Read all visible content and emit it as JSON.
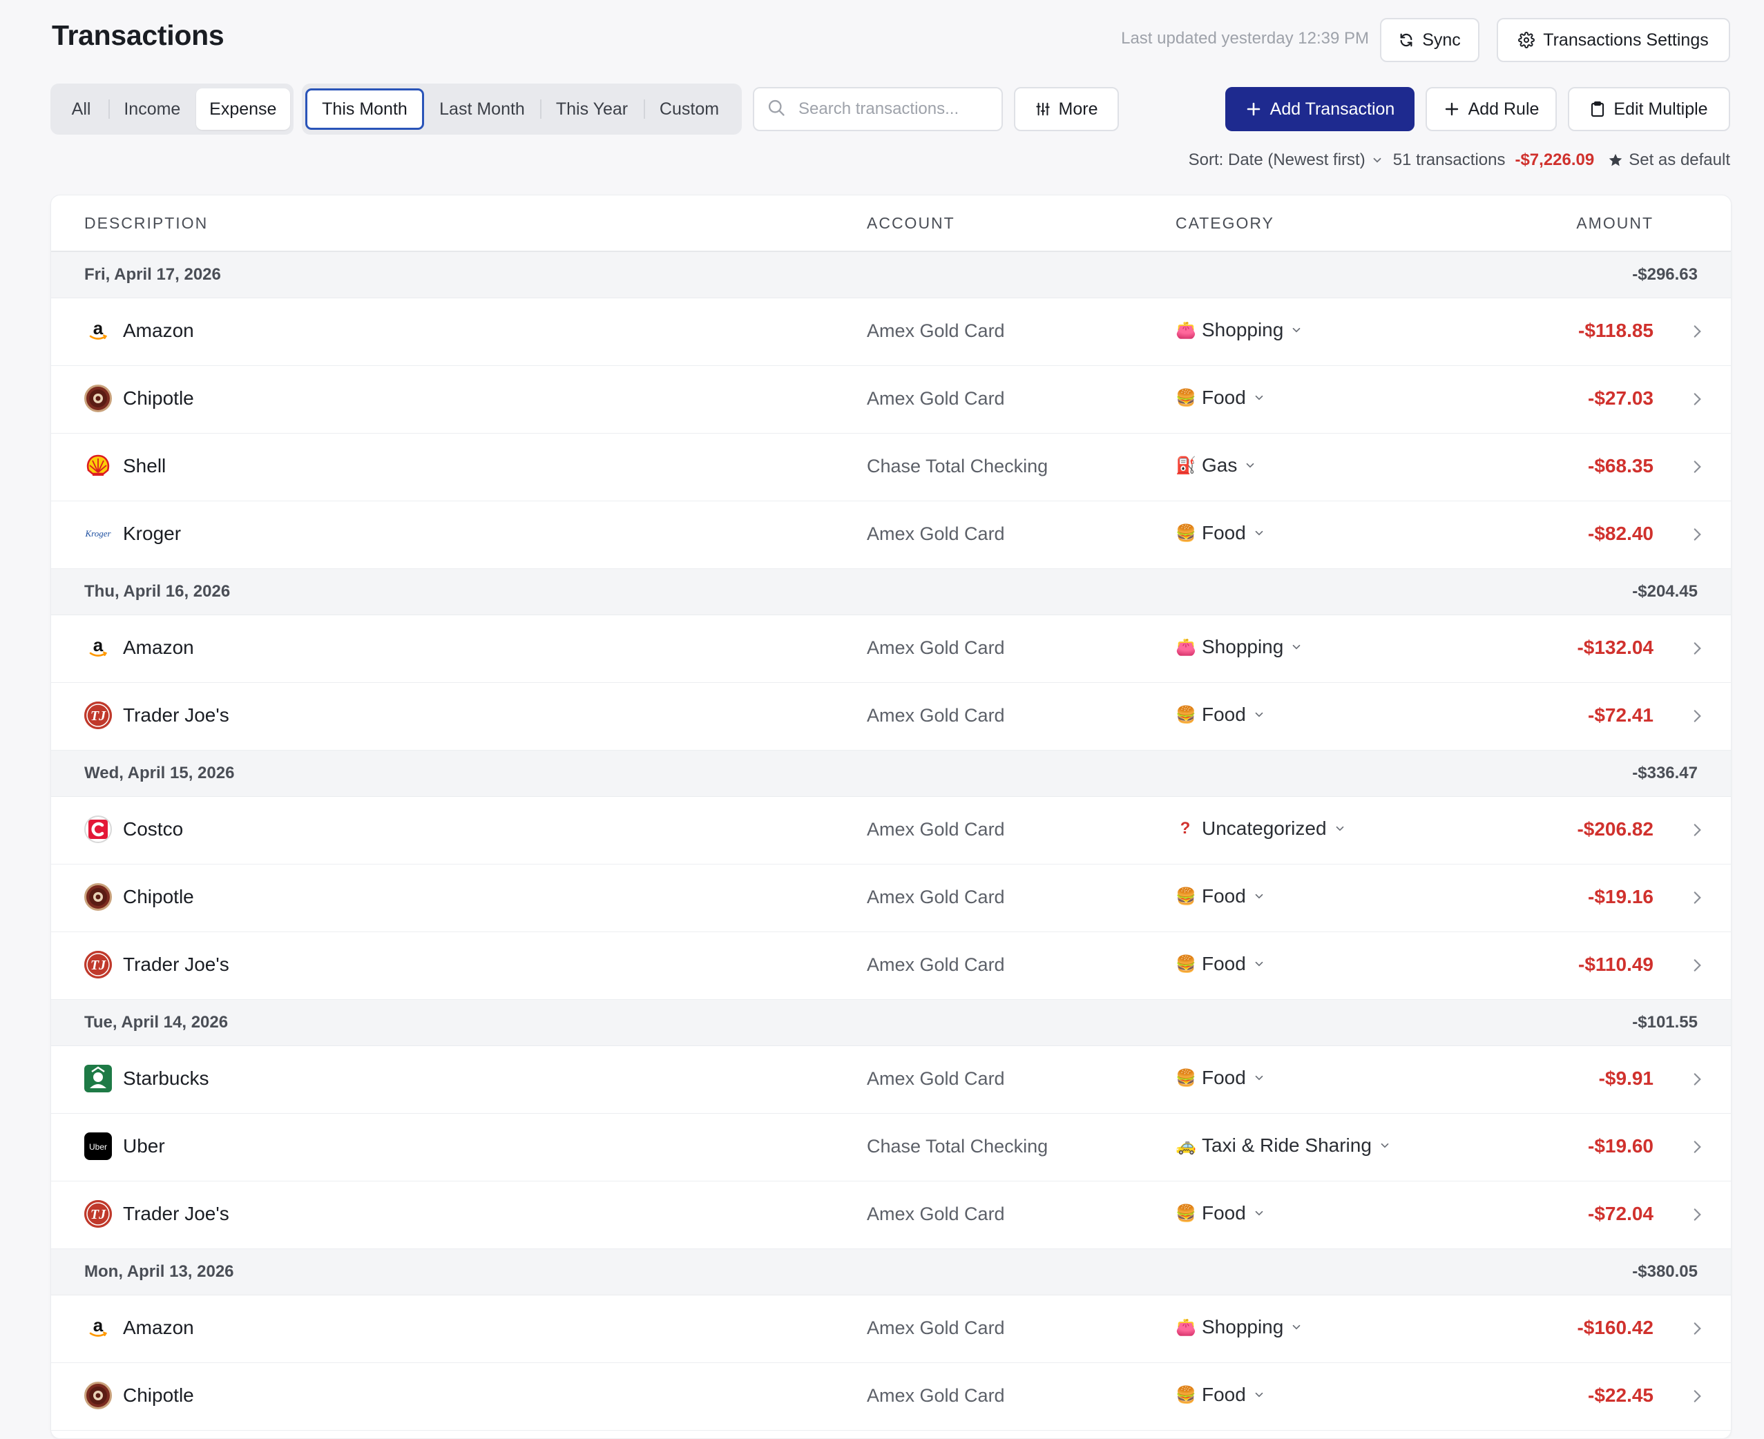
{
  "header": {
    "title": "Transactions",
    "last_updated": "Last updated yesterday 12:39 PM",
    "sync_label": "Sync",
    "settings_label": "Transactions Settings"
  },
  "filters": {
    "type_tabs": [
      {
        "label": "All",
        "active": false
      },
      {
        "label": "Income",
        "active": false
      },
      {
        "label": "Expense",
        "active": true
      }
    ],
    "period_tabs": [
      {
        "label": "This Month",
        "active": true
      },
      {
        "label": "Last Month",
        "active": false
      },
      {
        "label": "This Year",
        "active": false
      },
      {
        "label": "Custom",
        "active": false
      }
    ],
    "search_placeholder": "Search transactions...",
    "more_label": "More"
  },
  "actions": {
    "add_transaction": "Add Transaction",
    "add_rule": "Add Rule",
    "edit_multiple": "Edit Multiple"
  },
  "summary": {
    "sort_label": "Sort: Date (Newest first)",
    "count": "51 transactions",
    "total": "-$7,226.09",
    "set_default": "Set as default"
  },
  "table": {
    "columns": [
      "DESCRIPTION",
      "ACCOUNT",
      "CATEGORY",
      "AMOUNT"
    ],
    "groups": [
      {
        "date": "Fri, April 17, 2026",
        "total": "-$296.63",
        "rows": [
          {
            "merchant": "Amazon",
            "logo": "amazon-logo",
            "account": "Amex Gold Card",
            "category": "Shopping",
            "category_icon": "👛",
            "amount": "-$118.85"
          },
          {
            "merchant": "Chipotle",
            "logo": "chipotle-logo",
            "account": "Amex Gold Card",
            "category": "Food",
            "category_icon": "🍔",
            "amount": "-$27.03"
          },
          {
            "merchant": "Shell",
            "logo": "shell-logo",
            "account": "Chase Total Checking",
            "category": "Gas",
            "category_icon": "⛽",
            "amount": "-$68.35"
          },
          {
            "merchant": "Kroger",
            "logo": "kroger-logo",
            "account": "Amex Gold Card",
            "category": "Food",
            "category_icon": "🍔",
            "amount": "-$82.40"
          }
        ]
      },
      {
        "date": "Thu, April 16, 2026",
        "total": "-$204.45",
        "rows": [
          {
            "merchant": "Amazon",
            "logo": "amazon-logo",
            "account": "Amex Gold Card",
            "category": "Shopping",
            "category_icon": "👛",
            "amount": "-$132.04"
          },
          {
            "merchant": "Trader Joe's",
            "logo": "traderjoes-logo",
            "account": "Amex Gold Card",
            "category": "Food",
            "category_icon": "🍔",
            "amount": "-$72.41"
          }
        ]
      },
      {
        "date": "Wed, April 15, 2026",
        "total": "-$336.47",
        "rows": [
          {
            "merchant": "Costco",
            "logo": "costco-logo",
            "account": "Amex Gold Card",
            "category": "Uncategorized",
            "category_icon": "?",
            "amount": "-$206.82"
          },
          {
            "merchant": "Chipotle",
            "logo": "chipotle-logo",
            "account": "Amex Gold Card",
            "category": "Food",
            "category_icon": "🍔",
            "amount": "-$19.16"
          },
          {
            "merchant": "Trader Joe's",
            "logo": "traderjoes-logo",
            "account": "Amex Gold Card",
            "category": "Food",
            "category_icon": "🍔",
            "amount": "-$110.49"
          }
        ]
      },
      {
        "date": "Tue, April 14, 2026",
        "total": "-$101.55",
        "rows": [
          {
            "merchant": "Starbucks",
            "logo": "starbucks-logo",
            "account": "Amex Gold Card",
            "category": "Food",
            "category_icon": "🍔",
            "amount": "-$9.91"
          },
          {
            "merchant": "Uber",
            "logo": "uber-logo",
            "account": "Chase Total Checking",
            "category": "Taxi & Ride Sharing",
            "category_icon": "🚕",
            "amount": "-$19.60"
          },
          {
            "merchant": "Trader Joe's",
            "logo": "traderjoes-logo",
            "account": "Amex Gold Card",
            "category": "Food",
            "category_icon": "🍔",
            "amount": "-$72.04"
          }
        ]
      },
      {
        "date": "Mon, April 13, 2026",
        "total": "-$380.05",
        "rows": [
          {
            "merchant": "Amazon",
            "logo": "amazon-logo",
            "account": "Amex Gold Card",
            "category": "Shopping",
            "category_icon": "👛",
            "amount": "-$160.42"
          },
          {
            "merchant": "Chipotle",
            "logo": "chipotle-logo",
            "account": "Amex Gold Card",
            "category": "Food",
            "category_icon": "🍔",
            "amount": "-$22.45"
          }
        ]
      }
    ]
  },
  "colors": {
    "accent": "#1e2a8f",
    "expense_red": "#d0312d",
    "active_outline": "#2a54b8"
  }
}
